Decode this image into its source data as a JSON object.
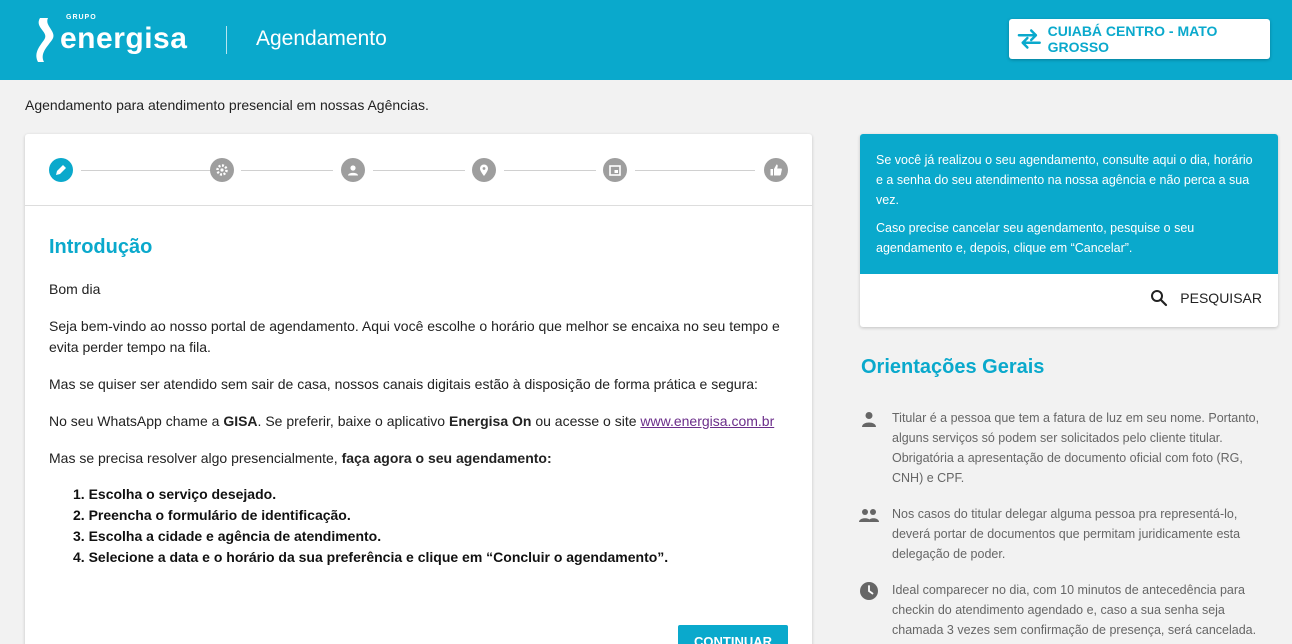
{
  "header": {
    "logo_group": "GRUPO",
    "logo_word": "energisa",
    "title": "Agendamento",
    "location": "CUIABÁ CENTRO - MATO GROSSO",
    "location_icon": "swap-arrows-icon",
    "brand_color": "#0aa9cc"
  },
  "subtitle": "Agendamento para atendimento presencial em nossas Agências.",
  "stepper": {
    "steps": [
      {
        "icon": "pencil-icon",
        "active": true
      },
      {
        "icon": "gear-icon",
        "active": false
      },
      {
        "icon": "person-icon",
        "active": false
      },
      {
        "icon": "location-pin-icon",
        "active": false
      },
      {
        "icon": "calendar-icon",
        "active": false
      },
      {
        "icon": "thumbs-up-icon",
        "active": false
      }
    ]
  },
  "intro": {
    "title": "Introdução",
    "greeting": "Bom dia",
    "p1": "Seja bem-vindo ao nosso portal de agendamento. Aqui você escolhe o horário que melhor se encaixa no seu tempo e evita perder tempo na fila.",
    "p2": "Mas se quiser ser atendido sem sair de casa, nossos canais digitais estão à disposição de forma prática e segura:",
    "p3_a": "No seu WhatsApp chame a ",
    "p3_gisa": "GISA",
    "p3_b": ". Se preferir, baixe o aplicativo ",
    "p3_app": "Energisa On",
    "p3_c": " ou acesse o site ",
    "p3_link": "www.energisa.com.br",
    "p4_a": "Mas se precisa resolver algo presencialmente, ",
    "p4_b": "faça agora o seu agendamento:",
    "steps": [
      "1. Escolha o serviço desejado.",
      "2. Preencha o formulário de identificação.",
      "3. Escolha a cidade e agência de atendimento.",
      "4. Selecione a data e o horário da sua preferência e clique em “Concluir o agendamento”."
    ],
    "continue_label": "CONTINUAR"
  },
  "info": {
    "text1": "Se você já realizou o seu agendamento, consulte aqui o dia, horário e a senha do seu atendimento na nossa agência e não perca a sua vez.",
    "text2": "Caso precise cancelar seu agendamento, pesquise o seu agendamento e, depois, clique em “Cancelar”.",
    "search_label": "PESQUISAR",
    "search_icon": "search-icon"
  },
  "orientacoes": {
    "title": "Orientações Gerais",
    "items": [
      {
        "icon": "person-icon",
        "text": "Titular é a pessoa que tem a fatura de luz em seu nome. Portanto, alguns serviços só podem ser solicitados pelo cliente titular. Obrigatória a apresentação de documento oficial com foto (RG, CNH) e CPF."
      },
      {
        "icon": "people-icon",
        "text": "Nos casos do titular delegar alguma pessoa pra representá-lo, deverá portar de documentos que permitam juridicamente esta delegação de poder."
      },
      {
        "icon": "clock-icon",
        "text": "Ideal comparecer no dia, com 10 minutos de antecedência para checkin do atendimento agendado e, caso a sua senha seja chamada 3 vezes sem confirmação de presença, será cancelada."
      }
    ]
  }
}
